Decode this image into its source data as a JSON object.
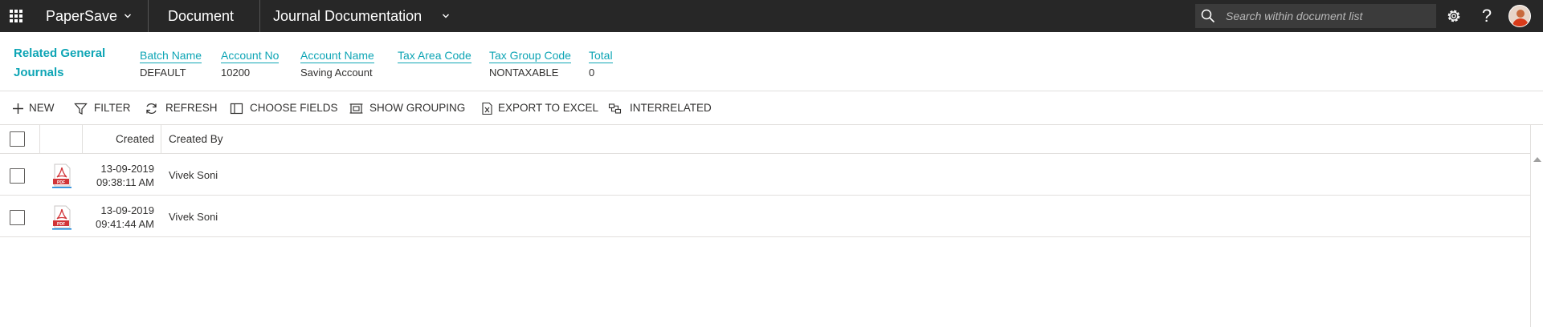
{
  "topbar": {
    "app_name": "PaperSave",
    "nav_document": "Document",
    "nav_journal": "Journal Documentation",
    "search_placeholder": "Search within document list",
    "help_glyph": "?"
  },
  "details": {
    "title": "Related General Journals",
    "fields": [
      {
        "label": "Batch Name",
        "value": "DEFAULT"
      },
      {
        "label": "Account No",
        "value": "10200"
      },
      {
        "label": "Account Name",
        "value": "Saving Account"
      },
      {
        "label": "Tax Area Code",
        "value": ""
      },
      {
        "label": "Tax Group Code",
        "value": "NONTAXABLE"
      },
      {
        "label": "Total",
        "value": "0"
      }
    ]
  },
  "commands": {
    "new": "NEW",
    "filter": "FILTER",
    "refresh": "REFRESH",
    "choose_fields": "CHOOSE FIELDS",
    "show_grouping": "SHOW GROUPING",
    "export": "EXPORT TO EXCEL",
    "interrelated": "INTERRELATED"
  },
  "grid": {
    "headers": {
      "created": "Created",
      "created_by": "Created By"
    },
    "rows": [
      {
        "date": "13-09-2019",
        "time": "09:38:11 AM",
        "created_by": "Vivek Soni",
        "file_icon": "pdf-icon"
      },
      {
        "date": "13-09-2019",
        "time": "09:41:44 AM",
        "created_by": "Vivek Soni",
        "file_icon": "pdf-icon"
      }
    ]
  },
  "colors": {
    "accent": "#0ea5b5",
    "topbar": "#272727",
    "pdf_red": "#d13438"
  }
}
